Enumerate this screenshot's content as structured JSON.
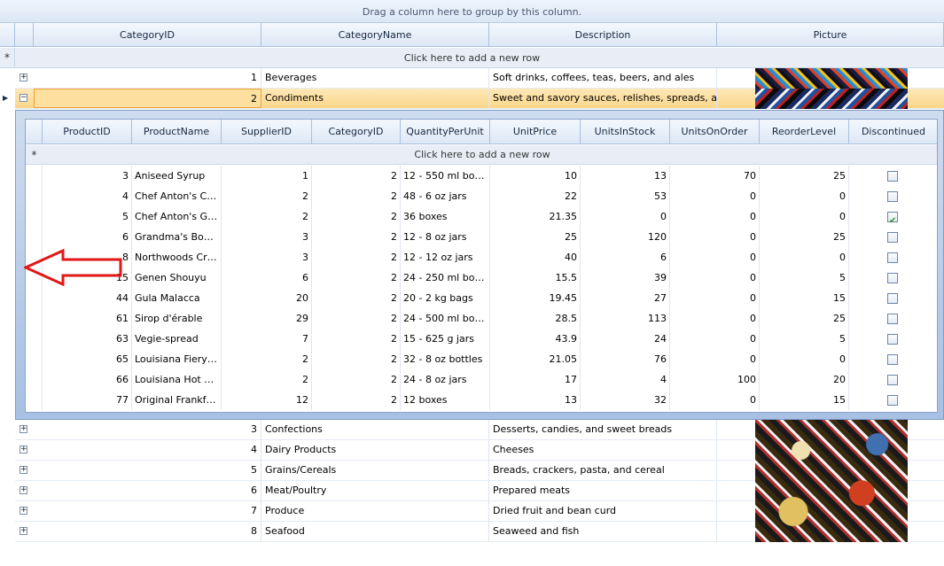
{
  "group_panel_text": "Drag a column here to group by this column.",
  "master_columns": [
    "CategoryID",
    "CategoryName",
    "Description",
    "Picture"
  ],
  "new_row_text": "Click here to add a new row",
  "master_rows": [
    {
      "id": "1",
      "name": "Beverages",
      "description": "Soft drinks, coffees, teas, beers, and ales",
      "expander": "+"
    },
    {
      "id": "2",
      "name": "Condiments",
      "description": "Sweet and savory sauces, relishes, spreads, and...",
      "expander": "−"
    },
    {
      "id": "3",
      "name": "Confections",
      "description": "Desserts, candies, and sweet breads",
      "expander": "+"
    },
    {
      "id": "4",
      "name": "Dairy Products",
      "description": "Cheeses",
      "expander": "+"
    },
    {
      "id": "5",
      "name": "Grains/Cereals",
      "description": "Breads, crackers, pasta, and cereal",
      "expander": "+"
    },
    {
      "id": "6",
      "name": "Meat/Poultry",
      "description": "Prepared meats",
      "expander": "+"
    },
    {
      "id": "7",
      "name": "Produce",
      "description": "Dried fruit and bean curd",
      "expander": "+"
    },
    {
      "id": "8",
      "name": "Seafood",
      "description": "Seaweed and fish",
      "expander": "+"
    }
  ],
  "detail_columns": [
    "ProductID",
    "ProductName",
    "SupplierID",
    "CategoryID",
    "QuantityPerUnit",
    "UnitPrice",
    "UnitsInStock",
    "UnitsOnOrder",
    "ReorderLevel",
    "Discontinued"
  ],
  "detail_rows": [
    {
      "pid": "3",
      "name": "Aniseed Syrup",
      "sid": "1",
      "cid": "2",
      "qty": "12 - 550 ml bottl...",
      "price": "10",
      "stock": "13",
      "order": "70",
      "reorder": "25",
      "disc": false
    },
    {
      "pid": "4",
      "name": "Chef Anton's Caj...",
      "sid": "2",
      "cid": "2",
      "qty": "48 - 6 oz jars",
      "price": "22",
      "stock": "53",
      "order": "0",
      "reorder": "0",
      "disc": false
    },
    {
      "pid": "5",
      "name": "Chef Anton's Gu...",
      "sid": "2",
      "cid": "2",
      "qty": "36 boxes",
      "price": "21.35",
      "stock": "0",
      "order": "0",
      "reorder": "0",
      "disc": true
    },
    {
      "pid": "6",
      "name": "Grandma's Boyse...",
      "sid": "3",
      "cid": "2",
      "qty": "12 - 8 oz jars",
      "price": "25",
      "stock": "120",
      "order": "0",
      "reorder": "25",
      "disc": false
    },
    {
      "pid": "8",
      "name": "Northwoods Cra...",
      "sid": "3",
      "cid": "2",
      "qty": "12 - 12 oz jars",
      "price": "40",
      "stock": "6",
      "order": "0",
      "reorder": "0",
      "disc": false
    },
    {
      "pid": "15",
      "name": "Genen Shouyu",
      "sid": "6",
      "cid": "2",
      "qty": "24 - 250 ml bottl...",
      "price": "15.5",
      "stock": "39",
      "order": "0",
      "reorder": "5",
      "disc": false
    },
    {
      "pid": "44",
      "name": "Gula Malacca",
      "sid": "20",
      "cid": "2",
      "qty": "20 - 2 kg bags",
      "price": "19.45",
      "stock": "27",
      "order": "0",
      "reorder": "15",
      "disc": false
    },
    {
      "pid": "61",
      "name": "Sirop d'érable",
      "sid": "29",
      "cid": "2",
      "qty": "24 - 500 ml bottl...",
      "price": "28.5",
      "stock": "113",
      "order": "0",
      "reorder": "25",
      "disc": false
    },
    {
      "pid": "63",
      "name": "Vegie-spread",
      "sid": "7",
      "cid": "2",
      "qty": "15 - 625 g jars",
      "price": "43.9",
      "stock": "24",
      "order": "0",
      "reorder": "5",
      "disc": false
    },
    {
      "pid": "65",
      "name": "Louisiana Fiery H...",
      "sid": "2",
      "cid": "2",
      "qty": "32 - 8 oz bottles",
      "price": "21.05",
      "stock": "76",
      "order": "0",
      "reorder": "0",
      "disc": false
    },
    {
      "pid": "66",
      "name": "Louisiana Hot Sp...",
      "sid": "2",
      "cid": "2",
      "qty": "24 - 8 oz jars",
      "price": "17",
      "stock": "4",
      "order": "100",
      "reorder": "20",
      "disc": false
    },
    {
      "pid": "77",
      "name": "Original Frankfur...",
      "sid": "12",
      "cid": "2",
      "qty": "12 boxes",
      "price": "13",
      "stock": "32",
      "order": "0",
      "reorder": "15",
      "disc": false
    }
  ],
  "colors": {
    "selected_row": "#fbd78a",
    "header": "#dde8f6",
    "arrow": "#e01818",
    "checkmark": "#2b9a2b"
  },
  "icons": {
    "new_row": "asterisk-icon",
    "current_row": "row-indicator-arrow-icon",
    "expand": "plus-icon",
    "collapse": "minus-icon",
    "annotation": "left-arrow-icon"
  }
}
